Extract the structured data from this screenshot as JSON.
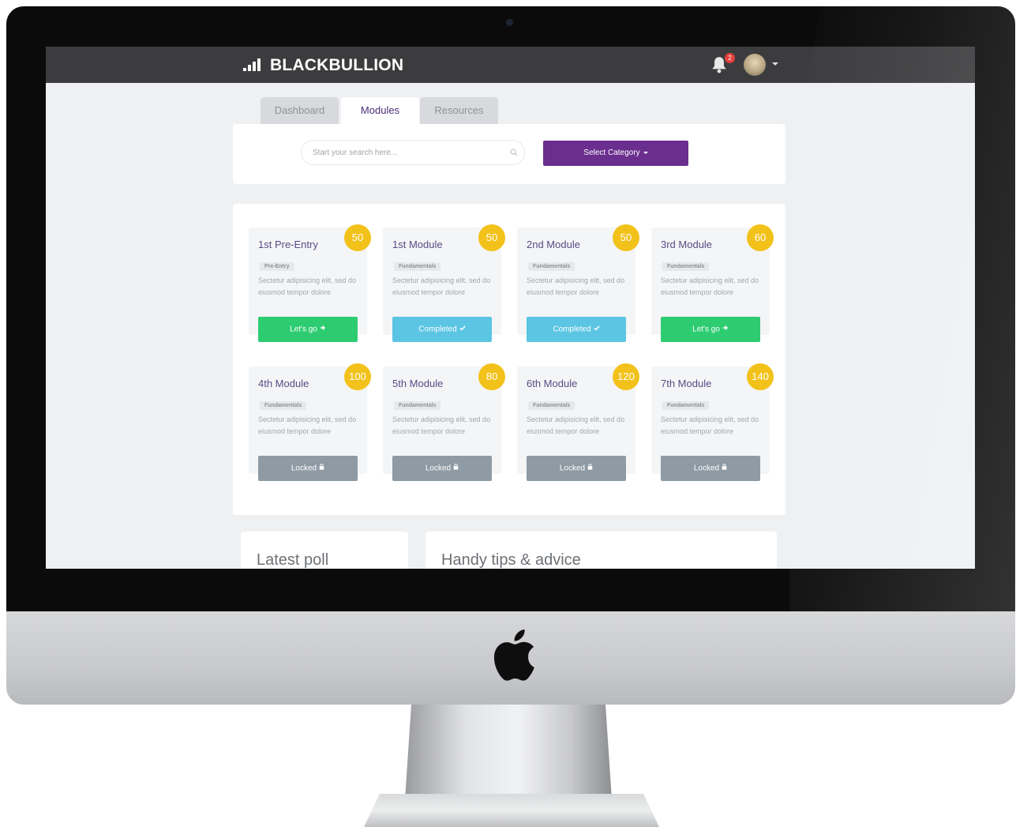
{
  "app": {
    "name": "BLACKBULLION"
  },
  "header": {
    "notification_count": "2"
  },
  "tabs": [
    {
      "label": "Dashboard",
      "active": false
    },
    {
      "label": "Modules",
      "active": true
    },
    {
      "label": "Resources",
      "active": false
    }
  ],
  "search": {
    "placeholder": "Start your search here...",
    "select_label": "Select Category"
  },
  "modules": [
    {
      "title": "1st Pre-Entry",
      "tag": "Pre-Entry",
      "points": "50",
      "description": "Sectetur adipisicing elit, sed do eiusmod tempor dolore",
      "button": "Let's go",
      "status": "go"
    },
    {
      "title": "1st Module",
      "tag": "Fundamentals",
      "points": "50",
      "description": "Sectetur adipisicing elit, sed do eiusmod tempor dolore",
      "button": "Completed",
      "status": "completed"
    },
    {
      "title": "2nd Module",
      "tag": "Fundamentals",
      "points": "50",
      "description": "Sectetur adipisicing elit, sed do eiusmod tempor dolore",
      "button": "Completed",
      "status": "completed"
    },
    {
      "title": "3rd Module",
      "tag": "Fundamentals",
      "points": "60",
      "description": "Sectetur adipisicing elit, sed do eiusmod tempor dolore",
      "button": "Let's go",
      "status": "go"
    },
    {
      "title": "4th Module",
      "tag": "Fundamentals",
      "points": "100",
      "description": "Sectetur adipisicing elit, sed do eiusmod tempor dolore",
      "button": "Locked",
      "status": "locked"
    },
    {
      "title": "5th Module",
      "tag": "Fundamentals",
      "points": "80",
      "description": "Sectetur adipisicing elit, sed do eiusmod tempor dolore",
      "button": "Locked",
      "status": "locked"
    },
    {
      "title": "6th Module",
      "tag": "Fundamentals",
      "points": "120",
      "description": "Sectetur adipisicing elit, sed do eiusmod tempor dolore",
      "button": "Locked",
      "status": "locked"
    },
    {
      "title": "7th Module",
      "tag": "Fundamentals",
      "points": "140",
      "description": "Sectetur adipisicing elit, sed do eiusmod tempor dolore",
      "button": "Locked",
      "status": "locked"
    }
  ],
  "panels": {
    "poll_title": "Latest poll",
    "tips_title": "Handy tips & advice"
  },
  "colors": {
    "brand": "#6a2e8e",
    "go": "#2ecc71",
    "completed": "#5bc5e3",
    "locked": "#8e9aa4",
    "points": "#f2c21b"
  },
  "icons": {
    "status_go": "arrow-right-icon",
    "status_completed": "check-icon",
    "status_locked": "lock-icon"
  }
}
